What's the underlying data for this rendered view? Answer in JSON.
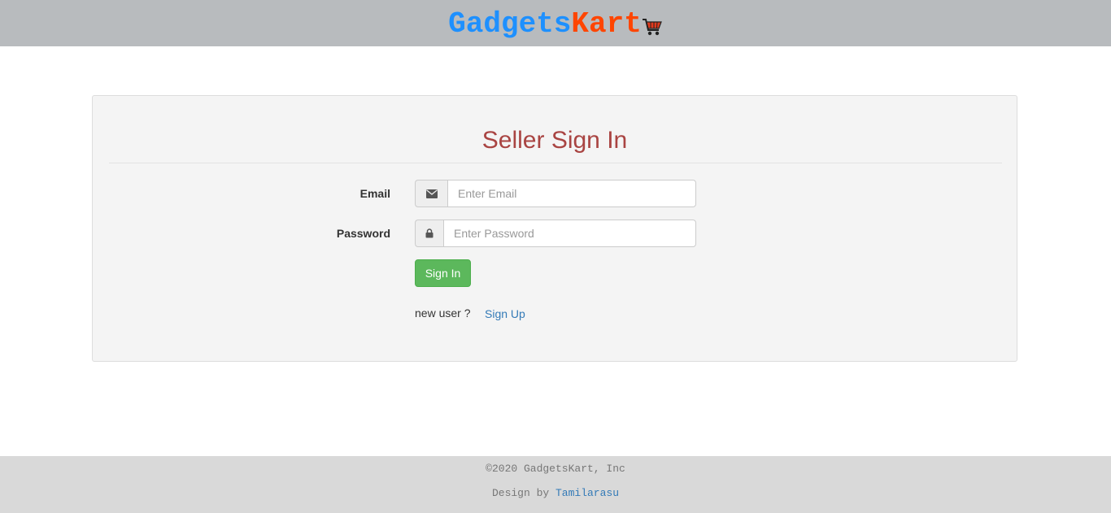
{
  "header": {
    "brand_part1": "Gadgets",
    "brand_part2": "Kart",
    "brand_color1": "#1e90ff",
    "brand_color2": "#ff4500",
    "cart_icon": "shopping-cart-icon"
  },
  "login": {
    "title": "Seller Sign In",
    "title_color": "#a94442",
    "email_label": "Email",
    "email_icon": "envelope-icon",
    "email_placeholder": "Enter Email",
    "email_value": "",
    "password_label": "Password",
    "password_icon": "lock-icon",
    "password_placeholder": "Enter Password",
    "password_value": "",
    "signin_label": "Sign In",
    "signin_color": "#5cb85c",
    "new_user_text": "new user ?",
    "signup_label": "Sign Up"
  },
  "footer": {
    "copyright": "©2020 GadgetsKart, Inc",
    "design_prefix": "Design by",
    "designer": "Tamilarasu"
  }
}
